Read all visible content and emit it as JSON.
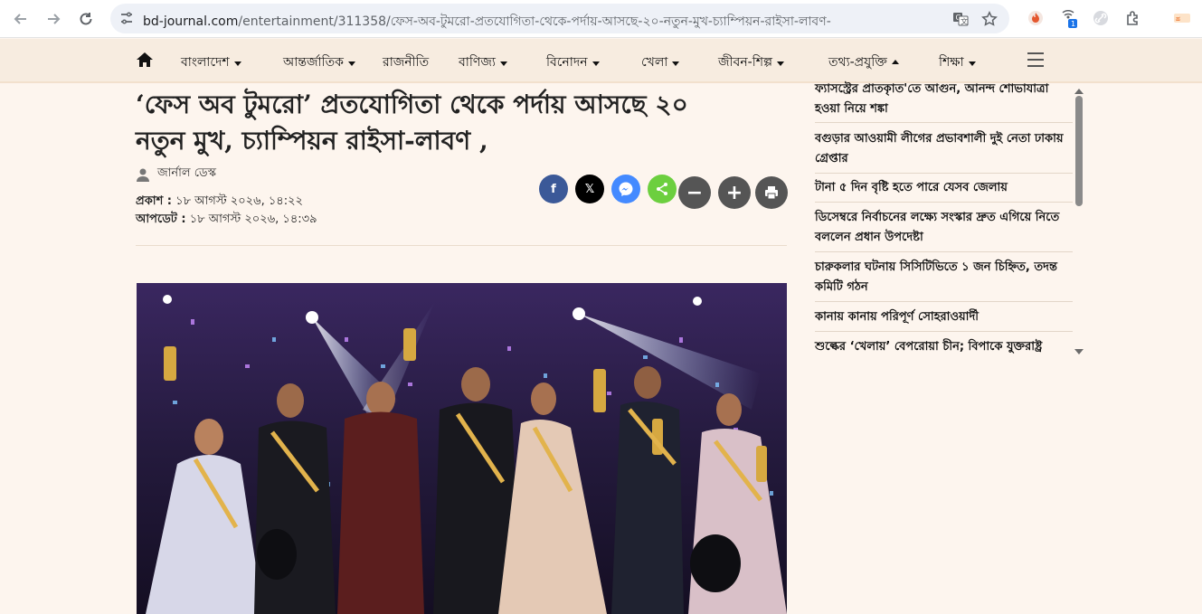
{
  "browser": {
    "url_host": "bd-journal.com",
    "url_path": "/entertainment/311358/ফেস-অব-টুমরো-প্রতযোগিতা-থেকে-পর্দায়-আসছে-২০-নতুন-মুখ-চ্যাম্পিয়ন-রাইসা-লাবণ-",
    "extension_badge": "1",
    "icons": [
      "back-icon",
      "forward-icon",
      "reload-icon",
      "tune-icon",
      "translate-icon",
      "star-icon",
      "extensions-icon"
    ]
  },
  "nav": {
    "items": [
      {
        "label": "বাংলাদেশ",
        "dropdown": true
      },
      {
        "label": "আন্তর্জাতিক",
        "dropdown": true
      },
      {
        "label": "রাজনীতি",
        "dropdown": false
      },
      {
        "label": "বাণিজ্য",
        "dropdown": true
      },
      {
        "label": "বিনোদন",
        "dropdown": true
      },
      {
        "label": "খেলা",
        "dropdown": true
      },
      {
        "label": "জীবন-শিল্প",
        "dropdown": true
      },
      {
        "label": "তথ্য-প্রযুক্তি",
        "dropdown": true
      },
      {
        "label": "শিক্ষা",
        "dropdown": true
      }
    ]
  },
  "article": {
    "headline_line1": "‘ফেস অব টুমরো’ প্রতযোগিতা থেকে পর্দায় আসছে ২০",
    "headline_line2": "নতুন মুখ, চ্যাম্পিয়ন রাইসা-লাবণ ,",
    "author": "জার্নাল ডেস্ক",
    "published_label": "প্রকাশ :",
    "published_value": "১৮ আগস্ট ২০২৬, ১৪:২২",
    "updated_label": "আপডেট :",
    "updated_value": "১৮ আগস্ট ২০২৬, ১৪:৩৯"
  },
  "share": {
    "facebook": "f",
    "x": "𝕏",
    "messenger": "m",
    "share": "<",
    "zoom_out": "−",
    "zoom_in": "+",
    "colors": {
      "facebook": "#3b5998",
      "x": "#000000",
      "messenger": "#448aff",
      "share": "#6ccf3f",
      "grey": "#555555"
    }
  },
  "sidebar": {
    "items": [
      "ফ্যাসস্ট্রের প্রাতকৃাত'তে আগুন, আনন্দ শোভাযাত্রা হওয়া নিয়ে শঙ্কা",
      "বগুড়ার আওয়ামী লীগের প্রভাবশালী দুই নেতা ঢাকায় গ্রেপ্তার",
      "টানা ৫ দিন বৃষ্টি হতে পারে যেসব জেলায়",
      "ডিসেম্বরে নির্বাচনের লক্ষ্যে সংস্কার দ্রুত এগিয়ে নিতে বললেন প্রধান উপদেষ্টা",
      "চারুকলার ঘটনায় সিসিটিভিতে ১ জন চিহ্নিত, তদন্ত কমিটি গঠন",
      "কানায় কানায় পরিপূর্ণ সোহরাওয়ার্দী",
      "শুল্কের ‘খেলায়’ বেপরোয়া চীন; বিপাকে যুক্তরাষ্ট্র"
    ]
  }
}
